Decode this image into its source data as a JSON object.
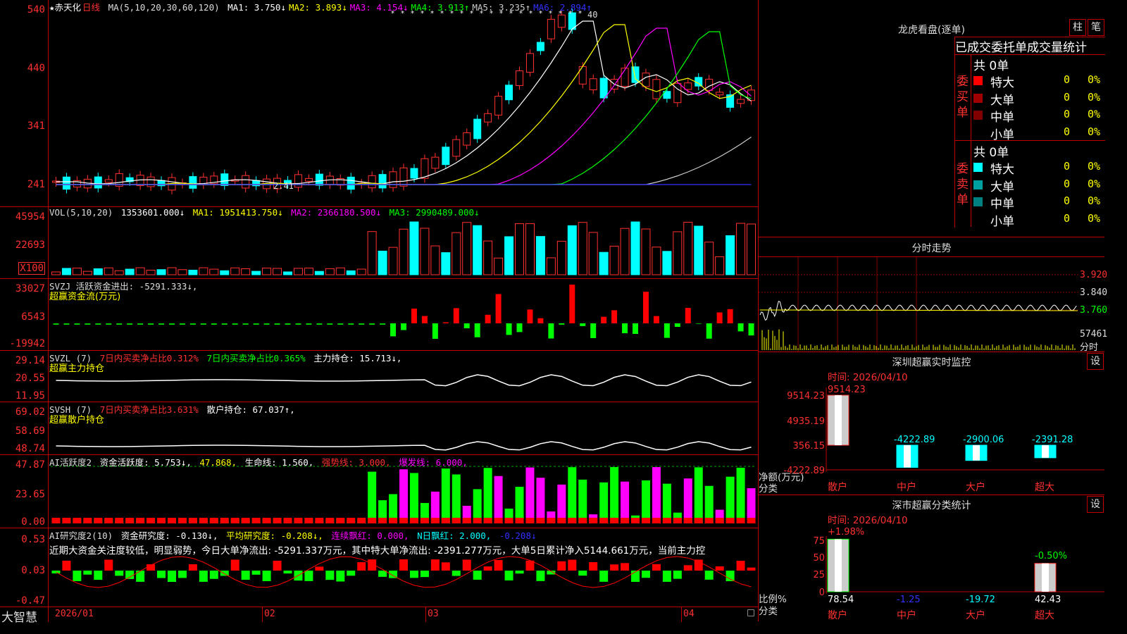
{
  "stock": {
    "name": "★赤天化",
    "period": "日线",
    "ma_header": "MA(5,10,20,30,60,120)",
    "ma": [
      {
        "label": "MA1:",
        "value": "3.750↓",
        "color": "#ffffff"
      },
      {
        "label": "MA2:",
        "value": "3.893↓",
        "color": "#ffff00"
      },
      {
        "label": "MA3:",
        "value": "4.154↓",
        "color": "#ff00ff"
      },
      {
        "label": "MA4:",
        "value": "3.913↑",
        "color": "#00ff00"
      },
      {
        "label": "MA5:",
        "value": "3.235↑",
        "color": "#cccccc"
      },
      {
        "label": "MA6:",
        "value": "2.894↑",
        "color": "#3030ff"
      }
    ],
    "price_axis": [
      "540",
      "440",
      "341",
      "241"
    ],
    "high_marker": "40",
    "low_marker": "2.41"
  },
  "vol": {
    "header": "VOL(5,10,20)",
    "value": "1353601.000↓",
    "ma1": "MA1: 1951413.750↓",
    "ma2": "MA2: 2366180.500↓",
    "ma3": "MA3: 2990489.000↓",
    "axis": [
      "45954",
      "22693"
    ],
    "unit": "X100"
  },
  "svzj": {
    "header": "SVZJ  活跃资金进出: -5291.333↓,",
    "sub": "超赢资金流(万元)",
    "axis": [
      "33027",
      "6543",
      "-19942"
    ]
  },
  "svzl": {
    "name": "SVZL (7)",
    "a": "7日内买卖净占比0.312%",
    "b": "7日内买卖净占比0.365%",
    "c": "主力持仓: 15.713↓,",
    "sub": "超赢主力持仓",
    "axis": [
      "29.14",
      "20.55",
      "11.95"
    ]
  },
  "svsh": {
    "name": "SVSH (7)",
    "a": "7日内买卖净占比3.631%",
    "c": "散户持仓: 67.037↑,",
    "sub": "超赢散户持仓",
    "axis": [
      "69.02",
      "58.69",
      "48.74"
    ]
  },
  "ai1": {
    "name": "AI活跃度2",
    "a": "资金活跃度: 5.753↓,",
    "b": "47.868,",
    "c": "生命线: 1.560,",
    "d": "强势线: 3.000,",
    "e": "爆发线: 6.000,",
    "axis": [
      "47.87",
      "23.65",
      "0.00"
    ]
  },
  "ai2": {
    "name": "AI研究度2(10)",
    "a": "资金研究度: -0.130↓,",
    "b": "平均研究度: -0.208↓,",
    "c": "连续飘红: 0.000,",
    "d": "N日飘红: 2.000,",
    "e": "-0.208↓",
    "text": "近期大资金关注度较低，明显弱势，今日大单净流出: -5291.337万元，其中特大单净流出: -2391.277万元，大单5日累计净入5144.661万元，当前主力控",
    "axis": [
      "0.53",
      "0.03",
      "-0.47"
    ]
  },
  "footer": {
    "brand": "大智慧",
    "dates": [
      "2026/01",
      "02",
      "03",
      "04"
    ]
  },
  "dragon": {
    "title": "龙虎看盘(逐单)",
    "btn1": "柱",
    "btn2": "笔",
    "subtitle": "已成交委托单成交量统计",
    "buy_label": "委买单",
    "sell_label": "委卖单",
    "buy_total": "共 0单",
    "sell_total": "共 0单",
    "buy_rows": [
      {
        "name": "特大",
        "count": "0",
        "pct": "0%",
        "color": "#ff0000"
      },
      {
        "name": "大单",
        "count": "0",
        "pct": "0%",
        "color": "#a00000"
      },
      {
        "name": "中单",
        "count": "0",
        "pct": "0%",
        "color": "#800000"
      },
      {
        "name": "小单",
        "count": "0",
        "pct": "0%",
        "color": ""
      }
    ],
    "sell_rows": [
      {
        "name": "特大",
        "count": "0",
        "pct": "0%",
        "color": "#00ffff"
      },
      {
        "name": "大单",
        "count": "0",
        "pct": "0%",
        "color": "#00a0a0"
      },
      {
        "name": "中单",
        "count": "0",
        "pct": "0%",
        "color": "#008080"
      },
      {
        "name": "小单",
        "count": "0",
        "pct": "0%",
        "color": ""
      }
    ]
  },
  "fenshi": {
    "title": "分时走势",
    "prices": [
      "3.920",
      "3.840",
      "3.760"
    ],
    "vol_label": "57461",
    "vol_unit": "分时"
  },
  "monitor": {
    "title": "深圳超赢实时监控",
    "btn": "设",
    "time": "时间: 2026/04/10",
    "axis": [
      "9514.23",
      "4935.19",
      "356.15",
      "-4222.89"
    ],
    "unit": "净额(万元)",
    "unit2": "分类",
    "bars": [
      {
        "label": "散户",
        "value": "9514.23"
      },
      {
        "label": "中户",
        "value": "-4222.89"
      },
      {
        "label": "大户",
        "value": "-2900.06"
      },
      {
        "label": "超大",
        "value": "-2391.28"
      }
    ]
  },
  "classify": {
    "title": "深市超赢分类统计",
    "btn": "设",
    "time": "时间: 2026/04/10",
    "axis": [
      "75",
      "50",
      "25",
      "0"
    ],
    "unit": "比例%",
    "unit2": "分类",
    "top_labels": [
      "+1.98%",
      "-0.50%"
    ],
    "bars": [
      {
        "label": "散户",
        "value": "78.54"
      },
      {
        "label": "中户",
        "value": "-1.25"
      },
      {
        "label": "大户",
        "value": "-19.72"
      },
      {
        "label": "超大",
        "value": "42.43"
      }
    ]
  }
}
